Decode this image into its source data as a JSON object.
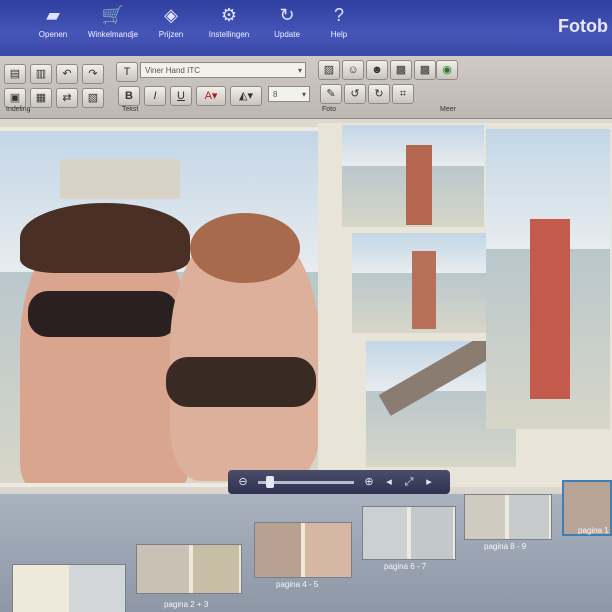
{
  "menu": {
    "items": [
      {
        "label": "Openen",
        "icon": "folder-open-icon"
      },
      {
        "label": "Winkelmandje",
        "icon": "cart-icon"
      },
      {
        "label": "Prijzen",
        "icon": "price-tag-icon"
      },
      {
        "label": "Instellingen",
        "icon": "gear-icon"
      },
      {
        "label": "Update",
        "icon": "refresh-icon"
      },
      {
        "label": "Help",
        "icon": "help-icon"
      }
    ],
    "brand": "Fotob"
  },
  "toolbar": {
    "font_name": "Viner Hand ITC",
    "font_size": "8",
    "groups": {
      "indeling": "Indeling",
      "tekst": "Tekst",
      "foto": "Foto",
      "meer": "Meer"
    },
    "bold": "B",
    "italic": "I",
    "underline": "U"
  },
  "filmstrip": {
    "pages": [
      {
        "label": ""
      },
      {
        "label": "pagina 2 + 3"
      },
      {
        "label": "pagina 4 - 5"
      },
      {
        "label": "pagina 6 - 7"
      },
      {
        "label": "pagina 8 - 9"
      },
      {
        "label": "pagina 1"
      }
    ]
  },
  "colors": {
    "menubar": "#3a48a6",
    "accent": "#3d7fb3"
  }
}
